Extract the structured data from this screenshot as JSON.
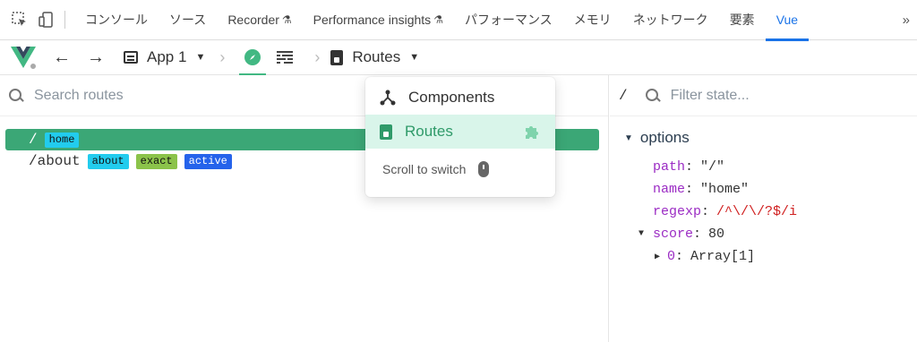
{
  "devtools": {
    "tabs": [
      {
        "label": "コンソール",
        "flask": false
      },
      {
        "label": "ソース",
        "flask": false
      },
      {
        "label": "Recorder",
        "flask": true
      },
      {
        "label": "Performance insights",
        "flask": true
      },
      {
        "label": "パフォーマンス",
        "flask": false
      },
      {
        "label": "メモリ",
        "flask": false
      },
      {
        "label": "ネットワーク",
        "flask": false
      },
      {
        "label": "要素",
        "flask": false
      },
      {
        "label": "Vue",
        "flask": false,
        "active": true
      }
    ],
    "more_label": "»",
    "flask_glyph": "⚗",
    "accent": "#1a73e8"
  },
  "toolbar": {
    "back_glyph": "←",
    "forward_glyph": "→",
    "app_label": "App 1",
    "caret_glyph": "▼",
    "crumb_glyph": "›",
    "routes_label": "Routes",
    "vue_green": "#42b883"
  },
  "routes": {
    "search_placeholder": "Search routes",
    "items": [
      {
        "path": "/",
        "badges": [
          {
            "text": "home",
            "color": "cyan"
          }
        ],
        "selected": true
      },
      {
        "path": "/about",
        "badges": [
          {
            "text": "about",
            "color": "cyan"
          },
          {
            "text": "exact",
            "color": "lime"
          },
          {
            "text": "active",
            "color": "blue"
          }
        ],
        "selected": false
      }
    ]
  },
  "state": {
    "path": "/",
    "filter_placeholder": "Filter state...",
    "section_label": "options",
    "props": [
      {
        "key": "path",
        "value": "\"/\"",
        "style": "plain"
      },
      {
        "key": "name",
        "value": "\"home\"",
        "style": "plain"
      },
      {
        "key": "regexp",
        "value": "/^\\/\\/?$/i",
        "style": "red"
      }
    ],
    "score": {
      "key": "score",
      "value": "80"
    },
    "score_item": {
      "key": "0",
      "value": "Array[1]"
    }
  },
  "dropdown": {
    "items": [
      {
        "label": "Components",
        "icon": "components-icon"
      },
      {
        "label": "Routes",
        "icon": "book-icon",
        "active": true
      }
    ],
    "hint": "Scroll to switch"
  }
}
